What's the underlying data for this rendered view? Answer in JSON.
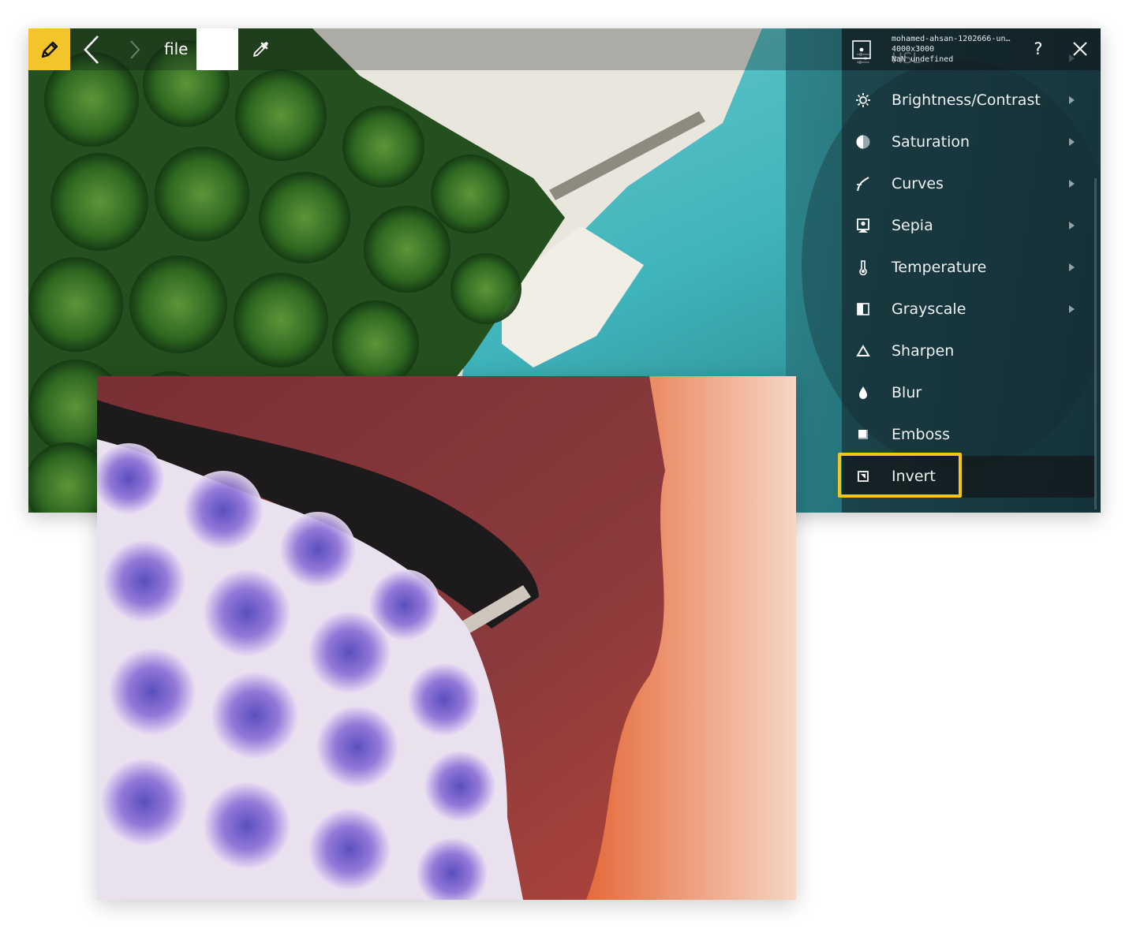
{
  "toolbar": {
    "logo_icon": "pencil-icon",
    "back_icon": "chevron-left-icon",
    "forward_icon": "chevron-right-icon",
    "file_label": "file",
    "swatch_color": "#ffffff",
    "picker_icon": "eyedropper-icon"
  },
  "file_info": {
    "name": "mohamed-ahsan-1202666-un…",
    "dimensions": "4000x3000",
    "meta": "NaN undefined"
  },
  "header": {
    "help_label": "?",
    "close_icon": "close-icon"
  },
  "menu": {
    "items": [
      {
        "label": "HSL",
        "icon": "sliders-icon",
        "has_submenu": true
      },
      {
        "label": "Brightness/Contrast",
        "icon": "sun-icon",
        "has_submenu": true
      },
      {
        "label": "Saturation",
        "icon": "half-circle-icon",
        "has_submenu": true
      },
      {
        "label": "Curves",
        "icon": "curve-icon",
        "has_submenu": true
      },
      {
        "label": "Sepia",
        "icon": "portrait-icon",
        "has_submenu": true
      },
      {
        "label": "Temperature",
        "icon": "thermometer-icon",
        "has_submenu": true
      },
      {
        "label": "Grayscale",
        "icon": "half-square-icon",
        "has_submenu": true
      },
      {
        "label": "Sharpen",
        "icon": "triangle-icon",
        "has_submenu": false
      },
      {
        "label": "Blur",
        "icon": "drop-icon",
        "has_submenu": false
      },
      {
        "label": "Emboss",
        "icon": "emboss-icon",
        "has_submenu": false
      },
      {
        "label": "Invert",
        "icon": "invert-icon",
        "has_submenu": false,
        "active": true
      }
    ]
  },
  "colors": {
    "accent": "#f5c518",
    "logo_bg": "#f3c52a"
  }
}
